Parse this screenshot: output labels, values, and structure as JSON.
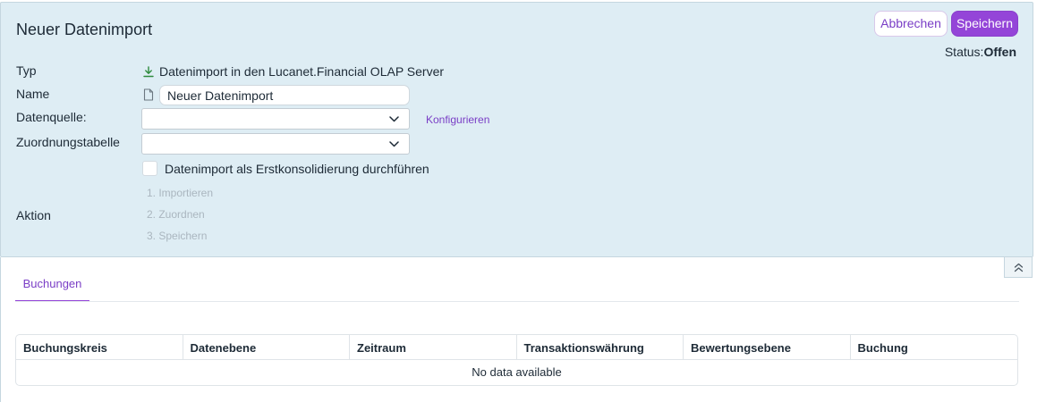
{
  "header": {
    "title": "Neuer Datenimport",
    "cancel_label": "Abbrechen",
    "save_label": "Speichern",
    "status_label": "Status:",
    "status_value": "Offen"
  },
  "form": {
    "typ_label": "Typ",
    "typ_value": "Datenimport in den Lucanet.Financial OLAP Server",
    "name_label": "Name",
    "name_value": "Neuer Datenimport",
    "datenquelle_label": "Datenquelle:",
    "datenquelle_value": "",
    "configure_link": "Konfigurieren",
    "zuordnung_label": "Zuordnungstabelle",
    "zuordnung_value": "",
    "checkbox_label": "Datenimport als Erstkonsolidierung durchführen",
    "checkbox_checked": false,
    "aktion_label": "Aktion",
    "steps": [
      "1. Importieren",
      "2. Zuordnen",
      "3. Speichern"
    ]
  },
  "tabs": [
    {
      "label": "Buchungen",
      "active": true
    }
  ],
  "table": {
    "columns": [
      "Buchungskreis",
      "Datenebene",
      "Zeitraum",
      "Transaktionswährung",
      "Bewertungsebene",
      "Buchung"
    ],
    "empty_text": "No data available"
  },
  "icons": {
    "typ": "download-icon",
    "name": "document-icon",
    "select": "chevron-down-icon",
    "collapse": "double-chevron-up-icon"
  },
  "colors": {
    "accent": "#9445d8",
    "panel_bg": "#deedf4",
    "download_icon": "#2e8b3d"
  }
}
